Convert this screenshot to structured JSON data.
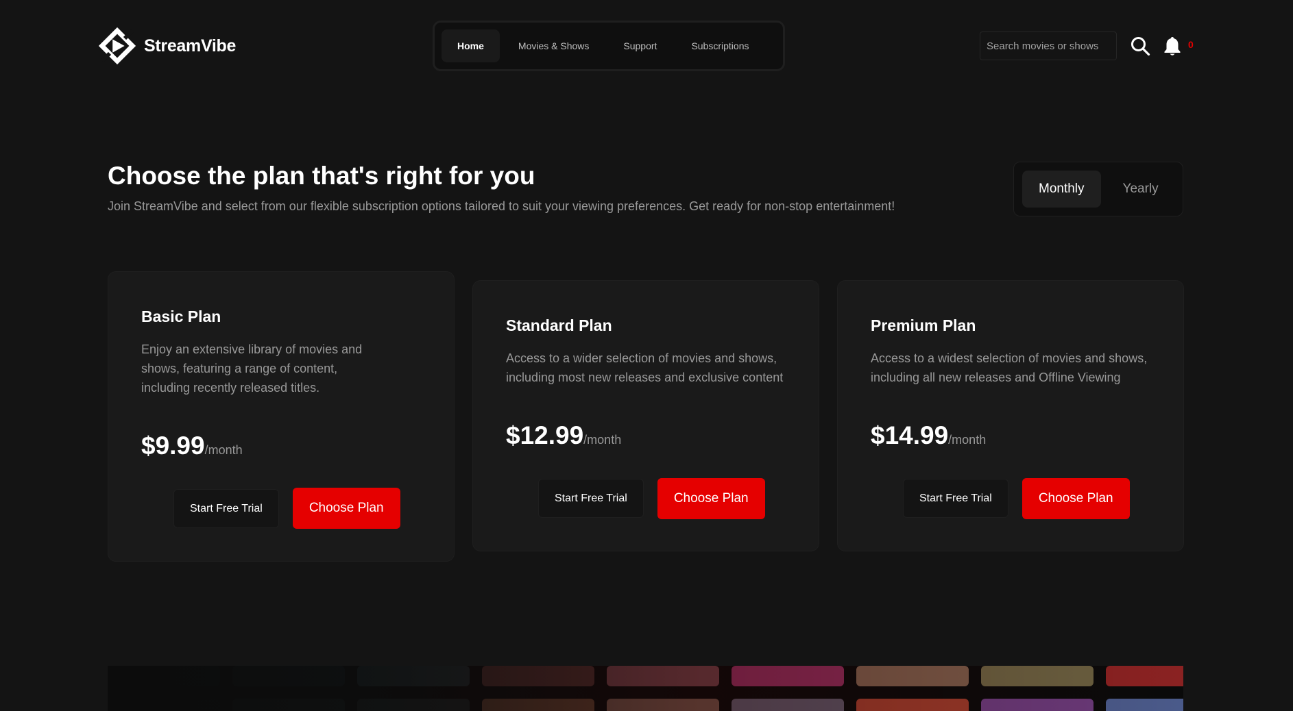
{
  "brand": {
    "name": "StreamVibe"
  },
  "nav": {
    "items": [
      {
        "label": "Home",
        "active": true
      },
      {
        "label": "Movies & Shows",
        "active": false
      },
      {
        "label": "Support",
        "active": false
      },
      {
        "label": "Subscriptions",
        "active": false
      }
    ]
  },
  "search": {
    "placeholder": "Search movies or shows",
    "value": ""
  },
  "notifications": {
    "count": "0"
  },
  "intro": {
    "title": "Choose the plan that's right for you",
    "subtitle": "Join StreamVibe and select from our flexible subscription options tailored to suit your viewing preferences. Get ready for non-stop entertainment!"
  },
  "billing_toggle": {
    "options": [
      "Monthly",
      "Yearly"
    ],
    "selected": "Monthly"
  },
  "plans": [
    {
      "title": "Basic Plan",
      "description": "Enjoy an extensive library of movies and shows, featuring a range of content, including recently released titles.",
      "price": "$9.99",
      "period": "/month",
      "trial_label": "Start Free Trial",
      "choose_label": "Choose Plan"
    },
    {
      "title": "Standard Plan",
      "description": "Access to a wider selection of movies and shows, including most new releases and exclusive content",
      "price": "$12.99",
      "period": "/month",
      "trial_label": "Start Free Trial",
      "choose_label": "Choose Plan"
    },
    {
      "title": "Premium Plan",
      "description": "Access to a widest selection of movies and shows, including all new releases and Offline Viewing",
      "price": "$14.99",
      "period": "/month",
      "trial_label": "Start Free Trial",
      "choose_label": "Choose Plan"
    }
  ],
  "colors": {
    "background": "#141414",
    "accent": "#e50000",
    "card": "#1a1a1a",
    "muted_text": "#999999"
  },
  "icons": {
    "search": "search-icon",
    "notifications": "bell-icon",
    "logo": "streamvibe-logo-icon"
  }
}
